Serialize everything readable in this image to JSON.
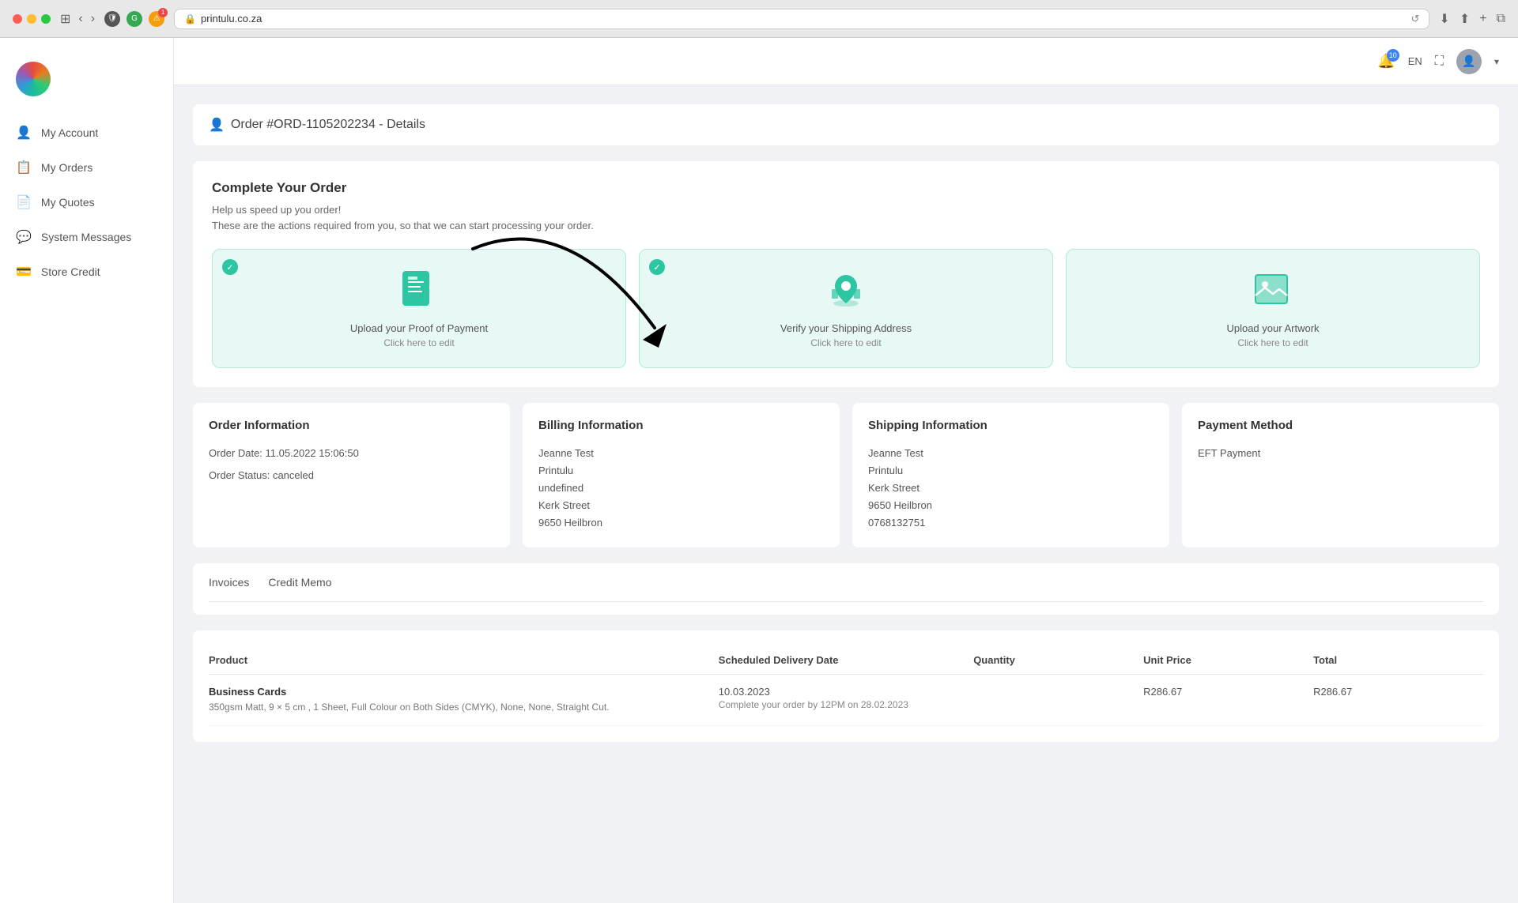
{
  "browser": {
    "url": "printulu.co.za",
    "reload_icon": "↺"
  },
  "topbar": {
    "notification_count": "10",
    "language": "EN"
  },
  "sidebar": {
    "nav_items": [
      {
        "label": "My Account",
        "icon": "👤"
      },
      {
        "label": "My Orders",
        "icon": "📋"
      },
      {
        "label": "My Quotes",
        "icon": "📄"
      },
      {
        "label": "System Messages",
        "icon": "💬"
      },
      {
        "label": "Store Credit",
        "icon": "💳"
      }
    ]
  },
  "page": {
    "header": "Order #ORD-1105202234 - Details",
    "complete_order": {
      "title": "Complete Your Order",
      "subtitle_line1": "Help us speed up you order!",
      "subtitle_line2": "These are the actions required from you, so that we can start processing your order."
    },
    "action_cards": [
      {
        "label": "Upload your Proof of Payment",
        "sublabel": "Click here to edit",
        "checked": true
      },
      {
        "label": "Verify your Shipping Address",
        "sublabel": "Click here to edit",
        "checked": true
      },
      {
        "label": "Upload your Artwork",
        "sublabel": "Click here to edit",
        "checked": false
      }
    ],
    "order_info": {
      "title": "Order Information",
      "date_label": "Order Date:",
      "date_value": "11.05.2022 15:06:50",
      "status_label": "Order Status:",
      "status_value": "canceled"
    },
    "billing_info": {
      "title": "Billing Information",
      "name": "Jeanne Test",
      "company": "Printulu",
      "address1": "undefined",
      "address2": "Kerk Street",
      "city": "9650 Heilbron"
    },
    "shipping_info": {
      "title": "Shipping Information",
      "name": "Jeanne Test",
      "company": "Printulu",
      "address": "Kerk Street",
      "city": "9650 Heilbron",
      "phone": "0768132751"
    },
    "payment_method": {
      "title": "Payment Method",
      "value": "EFT Payment"
    },
    "tabs": [
      {
        "label": "Invoices"
      },
      {
        "label": "Credit Memo"
      }
    ],
    "table": {
      "columns": [
        "Product",
        "Scheduled Delivery Date",
        "Quantity",
        "Unit Price",
        "Total"
      ],
      "rows": [
        {
          "product_name": "Business Cards",
          "product_desc": "350gsm Matt, 9 × 5 cm , 1 Sheet, Full Colour on Both Sides (CMYK), None, None, Straight Cut.",
          "delivery_date": "10.03.2023",
          "delivery_note": "Complete your order by 12PM on 28.02.2023",
          "quantity": "",
          "unit_price": "R286.67",
          "total": "R286.67"
        }
      ]
    }
  }
}
